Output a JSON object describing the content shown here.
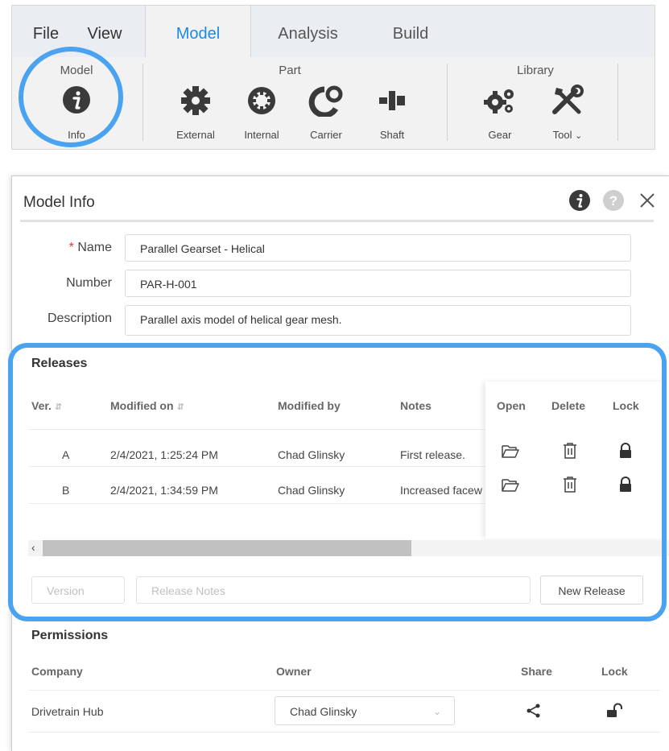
{
  "ribbon": {
    "tabs": [
      "File",
      "View",
      "Model",
      "Analysis",
      "Build"
    ],
    "active_tab": "Model",
    "groups": {
      "model": {
        "label": "Model",
        "buttons": [
          "Info"
        ]
      },
      "part": {
        "label": "Part",
        "buttons": [
          "External",
          "Internal",
          "Carrier",
          "Shaft"
        ]
      },
      "library": {
        "label": "Library",
        "buttons": [
          "Gear",
          "Tool"
        ]
      }
    },
    "tool_dropdown_icon": "chevron-down-icon"
  },
  "dialog": {
    "title": "Model Info",
    "icons": [
      "info-icon",
      "help-icon",
      "close-icon"
    ],
    "fields": {
      "name_label": "Name",
      "name_required_mark": "*",
      "name_value": "Parallel Gearset - Helical",
      "number_label": "Number",
      "number_value": "PAR-H-001",
      "description_label": "Description",
      "description_value": "Parallel axis model of helical gear mesh."
    },
    "releases": {
      "title": "Releases",
      "columns": [
        "Ver.",
        "Modified on",
        "Modified by",
        "Notes",
        "Open",
        "Delete",
        "Lock"
      ],
      "rows": [
        {
          "ver": "A",
          "modified_on": "2/4/2021, 1:25:24 PM",
          "modified_by": "Chad Glinsky",
          "notes": "First release."
        },
        {
          "ver": "B",
          "modified_on": "2/4/2021, 1:34:59 PM",
          "modified_by": "Chad Glinsky",
          "notes": "Increased facew"
        }
      ],
      "version_placeholder": "Version",
      "notes_placeholder": "Release Notes",
      "new_release_label": "New Release"
    },
    "permissions": {
      "title": "Permissions",
      "columns": [
        "Company",
        "Owner",
        "Share",
        "Lock"
      ],
      "rows": [
        {
          "company": "Drivetrain Hub",
          "owner": "Chad Glinsky"
        }
      ]
    }
  },
  "colors": {
    "accent": "#1e88e5",
    "highlight": "#4aa3f0",
    "required": "#e33333"
  }
}
